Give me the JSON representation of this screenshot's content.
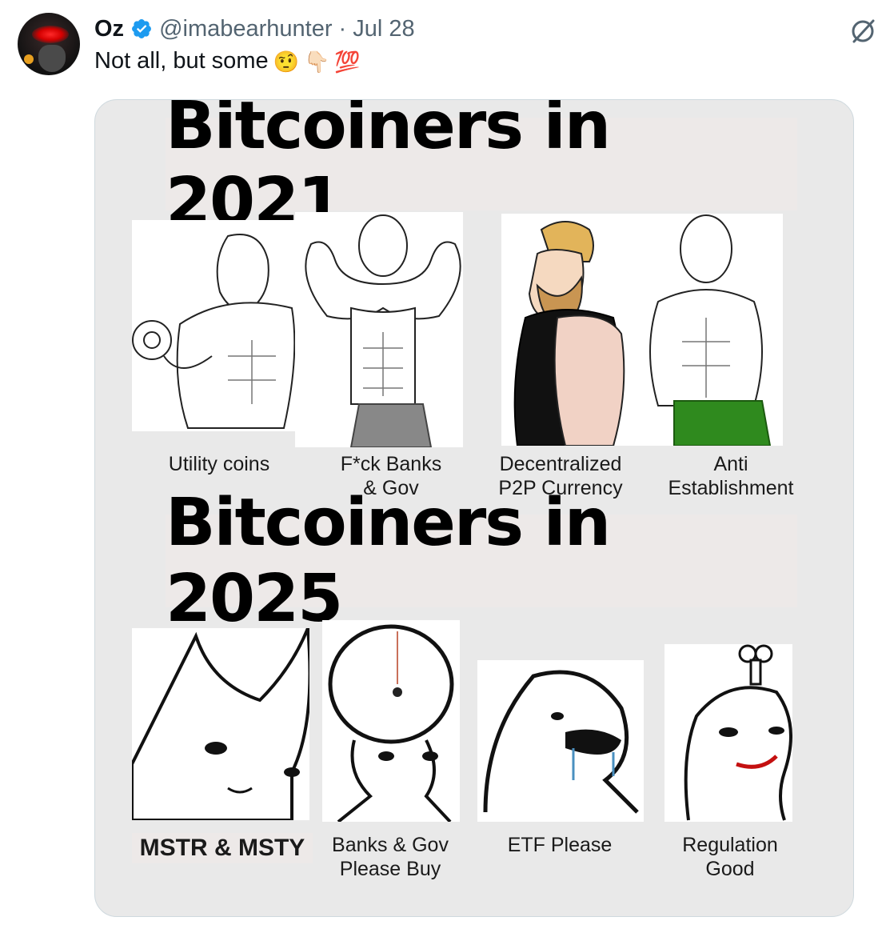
{
  "tweet": {
    "author_name": "Oz",
    "handle": "@imabearhunter",
    "separator": "·",
    "date": "Jul 28",
    "text": "Not all, but some",
    "emojis": [
      "🤨",
      "👇🏻",
      "💯"
    ]
  },
  "meme": {
    "title_top": "Bitcoiners in 2021",
    "title_bottom": "Bitcoiners in 2025",
    "top_labels": [
      {
        "line1": "Utility coins",
        "line2": ""
      },
      {
        "line1": "F*ck Banks",
        "line2": "& Gov"
      },
      {
        "line1": "Decentralized",
        "line2": "P2P Currency"
      },
      {
        "line1": "Anti",
        "line2": "Establishment"
      }
    ],
    "bottom_labels": [
      {
        "line1": "MSTR & MSTY",
        "line2": ""
      },
      {
        "line1": "Banks & Gov",
        "line2": "Please Buy"
      },
      {
        "line1": "ETF Please",
        "line2": ""
      },
      {
        "line1": "Regulation",
        "line2": "Good"
      }
    ]
  },
  "colors": {
    "verified": "#1d9bf0",
    "secondary_text": "#536471",
    "card_bg": "#e9e9e9"
  },
  "icons": [
    "verified-badge-icon",
    "grok-icon"
  ]
}
